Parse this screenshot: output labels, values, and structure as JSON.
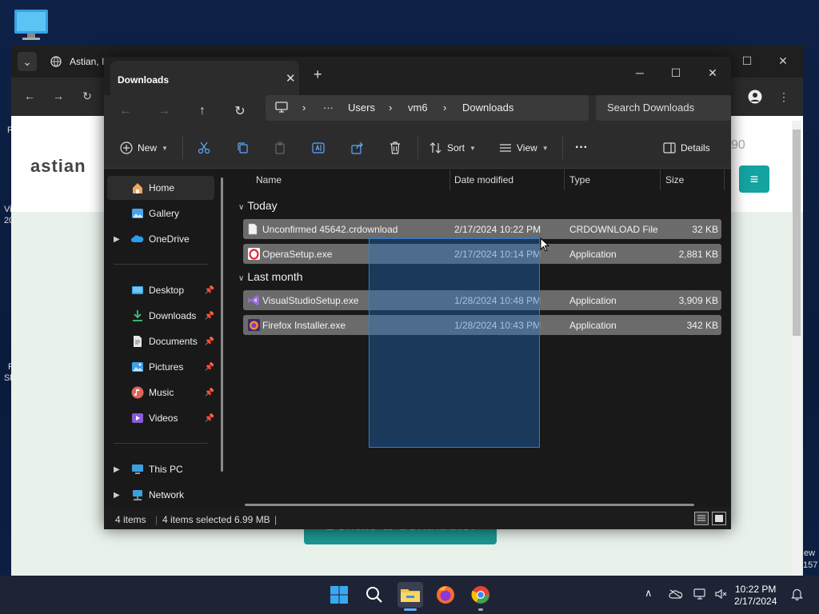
{
  "desktop": {
    "fragments": [
      "R",
      "Vi",
      "20",
      "F",
      "Sl",
      "ew",
      "157"
    ]
  },
  "browser": {
    "tab_title": "Astian, I",
    "logo_text": "astian",
    "right_frag": "90",
    "donate_label": "Donate & Contribute!"
  },
  "explorer": {
    "tab_title": "Downloads",
    "breadcrumb": [
      "Users",
      "vm6",
      "Downloads"
    ],
    "search_placeholder": "Search Downloads",
    "commands": {
      "new": "New",
      "sort": "Sort",
      "view": "View",
      "details": "Details"
    },
    "nav": [
      {
        "label": "Home",
        "icon": "home-icon"
      },
      {
        "label": "Gallery",
        "icon": "gallery-icon"
      },
      {
        "label": "OneDrive",
        "icon": "onedrive-icon"
      },
      {
        "label": "Desktop",
        "icon": "desktop-folder-icon"
      },
      {
        "label": "Downloads",
        "icon": "downloads-icon"
      },
      {
        "label": "Documents",
        "icon": "documents-icon"
      },
      {
        "label": "Pictures",
        "icon": "pictures-icon"
      },
      {
        "label": "Music",
        "icon": "music-icon"
      },
      {
        "label": "Videos",
        "icon": "videos-icon"
      },
      {
        "label": "This PC",
        "icon": "this-pc-icon"
      },
      {
        "label": "Network",
        "icon": "network-icon"
      }
    ],
    "columns": [
      "Name",
      "Date modified",
      "Type",
      "Size"
    ],
    "groups": [
      "Today",
      "Last month"
    ],
    "files": [
      {
        "name": "Unconfirmed 45642.crdownload",
        "date": "2/17/2024 10:22 PM",
        "type": "CRDOWNLOAD File",
        "size": "32 KB",
        "icon": "file-icon"
      },
      {
        "name": "OperaSetup.exe",
        "date": "2/17/2024 10:14 PM",
        "type": "Application",
        "size": "2,881 KB",
        "icon": "opera-icon"
      },
      {
        "name": "VisualStudioSetup.exe",
        "date": "1/28/2024 10:48 PM",
        "type": "Application",
        "size": "3,909 KB",
        "icon": "visual-studio-icon"
      },
      {
        "name": "Firefox Installer.exe",
        "date": "1/28/2024 10:43 PM",
        "type": "Application",
        "size": "342 KB",
        "icon": "firefox-icon"
      }
    ],
    "status": {
      "items": "4 items",
      "selected": "4 items selected",
      "size": "6.99 MB"
    }
  },
  "taskbar": {
    "time": "10:22 PM",
    "date": "2/17/2024"
  },
  "colors": {
    "accent_teal": "#14a3a0",
    "selection": "#6b6b6b",
    "marquee": "#2b7fd4"
  }
}
